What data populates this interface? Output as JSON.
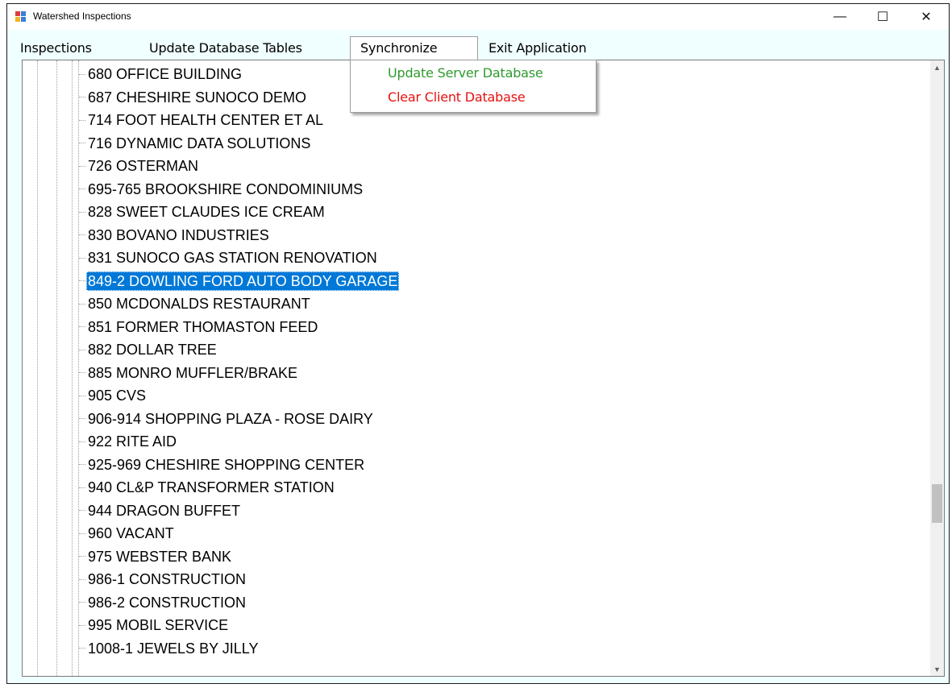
{
  "window": {
    "title": "Watershed Inspections",
    "controls": {
      "minimize": "—",
      "maximize": "☐",
      "close": "✕"
    }
  },
  "menu": {
    "items": [
      {
        "label": "Inspections"
      },
      {
        "label": "Update Database Tables"
      },
      {
        "label": "Synchronize"
      },
      {
        "label": "Exit Application"
      }
    ],
    "open_index": 2,
    "dropdown": [
      {
        "label": "Update Server Database",
        "color": "#2e9a2e"
      },
      {
        "label": "Clear Client Database",
        "color": "#e81010"
      }
    ]
  },
  "tree": {
    "nodes": [
      "680 OFFICE BUILDING",
      "687 CHESHIRE SUNOCO DEMO",
      "714 FOOT HEALTH CENTER ET AL",
      "716 DYNAMIC DATA SOLUTIONS",
      "726 OSTERMAN",
      "695-765  BROOKSHIRE CONDOMINIUMS",
      "828 SWEET CLAUDES ICE CREAM",
      "830 BOVANO INDUSTRIES",
      "831 SUNOCO GAS STATION RENOVATION",
      "849-2 DOWLING FORD AUTO BODY GARAGE",
      "850 MCDONALDS RESTAURANT",
      "851 FORMER THOMASTON FEED",
      "882 DOLLAR TREE",
      "885 MONRO MUFFLER/BRAKE",
      "905 CVS",
      "906-914  SHOPPING PLAZA - ROSE DAIRY",
      "922 RITE AID",
      "925-969  CHESHIRE SHOPPING CENTER",
      "940 CL&P TRANSFORMER STATION",
      "944 DRAGON BUFFET",
      "960 VACANT",
      "975 WEBSTER BANK",
      "986-1  CONSTRUCTION",
      "986-2  CONSTRUCTION",
      "995 MOBIL SERVICE",
      "1008-1  JEWELS BY JILLY"
    ],
    "selected_index": 9,
    "scroll_position": 0.72
  },
  "colors": {
    "selection": "#0078d7",
    "app_background": "#f0ffff"
  }
}
